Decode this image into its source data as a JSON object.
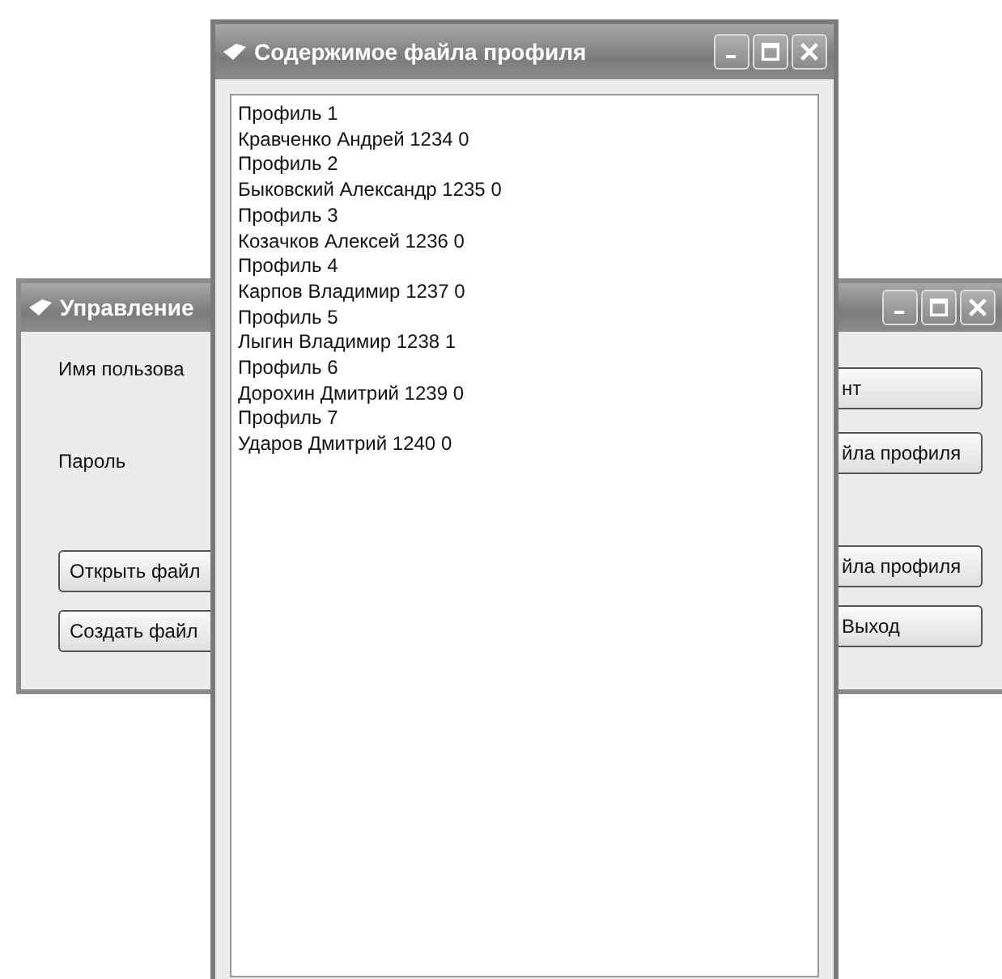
{
  "main_window": {
    "title": "Управление",
    "labels": [
      "Имя пользова",
      "Пароль"
    ],
    "left_buttons": [
      "Открыть файл",
      "Создать файл"
    ],
    "right_buttons": [
      "нт",
      "йла профиля",
      "йла профиля",
      "Выход"
    ]
  },
  "profile_window": {
    "title": "Содержимое файла профиля",
    "lines": [
      "Профиль 1",
      "Кравченко Андрей 1234 0",
      "Профиль 2",
      "Быковский Александр 1235 0",
      "Профиль 3",
      "Козачков Алексей 1236 0",
      "Профиль 4",
      "Карпов Владимир 1237 0",
      "Профиль 5",
      "Лыгин Владимир 1238 1",
      "Профиль 6",
      "Дорохин Дмитрий 1239 0",
      "Профиль 7",
      "Ударов Дмитрий 1240 0"
    ]
  }
}
